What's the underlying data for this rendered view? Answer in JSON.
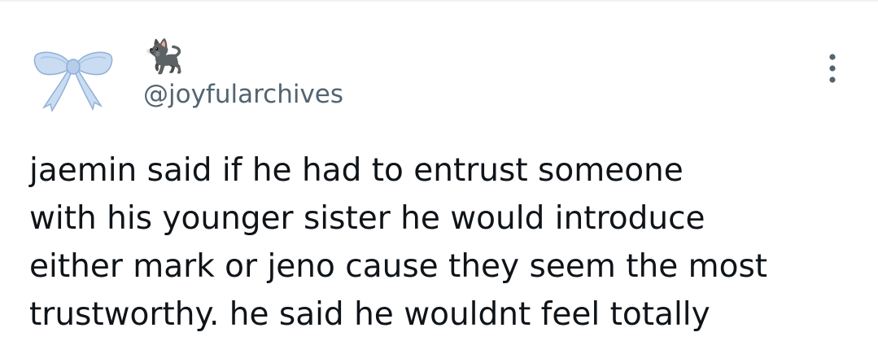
{
  "tweet": {
    "author": {
      "display_name": "🐈‍⬛",
      "handle": "@joyfularchives",
      "avatar_icon": "blue-ribbon-bow-icon"
    },
    "more_icon": "more-vertical-icon",
    "text": "jaemin said if he had to entrust someone\nwith his younger sister he would introduce\neither mark or jeno cause they seem the most\ntrustworthy. he said he wouldnt feel totally"
  },
  "colors": {
    "text": "#0f1419",
    "secondary_text": "#536471",
    "bow_blue": "#bcd3ee",
    "divider": "#eff3f4"
  }
}
